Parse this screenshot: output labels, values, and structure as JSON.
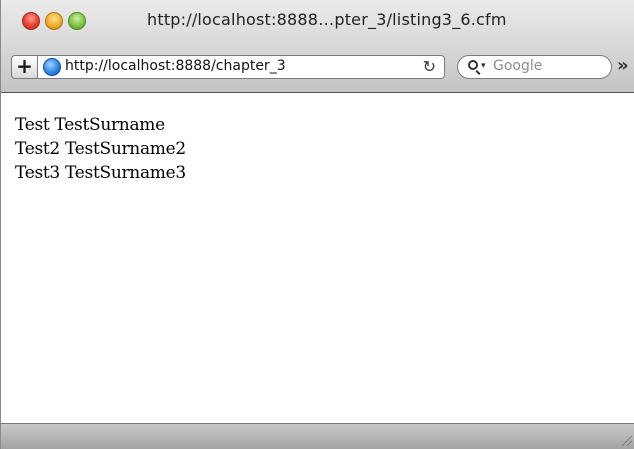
{
  "window": {
    "title": "http://localhost:8888…pter_3/listing3_6.cfm"
  },
  "toolbar": {
    "add_label": "+",
    "url": "http://localhost:8888/chapter_3",
    "reload_icon": "reload-icon",
    "search_placeholder": "Google",
    "overflow_label": "»"
  },
  "content": {
    "rows": [
      "Test TestSurname",
      "Test2 TestSurname2",
      "Test3 TestSurname3"
    ]
  },
  "colors": {
    "page_background": "#ffffff",
    "text": "#000000"
  }
}
